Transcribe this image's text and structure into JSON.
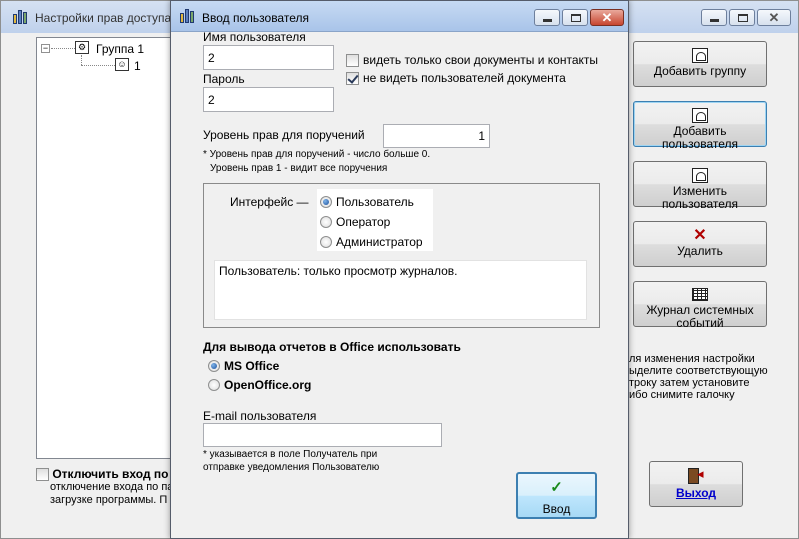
{
  "bg_window": {
    "title": "Настройки прав доступа",
    "tree": {
      "group": "Группа 1",
      "user": "1"
    },
    "disable_login": {
      "label": "Отключить вход по",
      "note1": "отключение входа по па",
      "note2": "загрузке программы. П"
    },
    "buttons": {
      "add_group": "Добавить группу",
      "add_user": "Добавить пользователя",
      "edit_user": "Изменить пользователя",
      "delete": "Удалить",
      "journal_l1": "Журнал системных",
      "journal_l2": "событий",
      "exit": "Выход"
    },
    "help": {
      "l1": "ля изменения настройки",
      "l2": "ыделите соответствующую",
      "l3": "троку затем установите",
      "l4": "ибо снимите галочку"
    }
  },
  "dialog": {
    "title": "Ввод пользователя",
    "username_label": "Имя пользователя",
    "username_value": "2",
    "password_label": "Пароль",
    "password_value": "2",
    "own_docs_label": "видеть только свои документы и контакты",
    "own_docs_checked": false,
    "hide_users_label": "не видеть пользователей документа",
    "hide_users_checked": true,
    "rights_label": "Уровень прав для поручений",
    "rights_value": "1",
    "rights_note1": "* Уровень прав для поручений - число больше 0.",
    "rights_note2": "Уровень прав 1 - видит все поручения",
    "interface_label": "Интерфейс —",
    "interface_options": [
      "Пользователь",
      "Оператор",
      "Администратор"
    ],
    "interface_selected": "Пользователь",
    "interface_description": "Пользователь: только просмотр журналов.",
    "office_label": "Для вывода отчетов в Office использовать",
    "office_options": [
      "MS Office",
      "OpenOffice.org"
    ],
    "office_selected": "MS Office",
    "email_label": "E-mail пользователя",
    "email_value": "",
    "email_note1": "* указывается в поле Получатель при",
    "email_note2": "отправке уведомления Пользователю",
    "enter_button": "Ввод"
  },
  "colors": {
    "accent": "#3c7fb1",
    "titlebar": "#c6daf3",
    "exit_link": "#0000cc"
  }
}
